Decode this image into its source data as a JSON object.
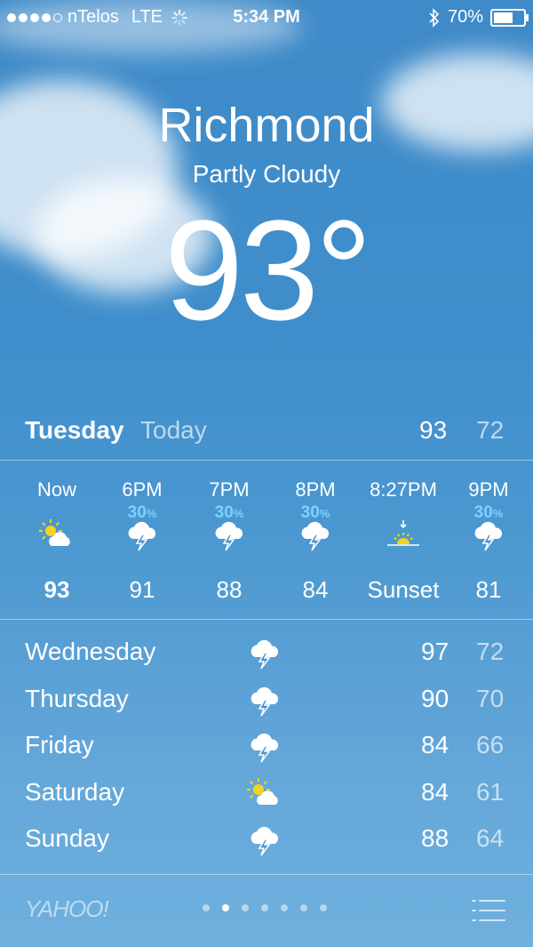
{
  "status": {
    "carrier": "nTelos",
    "network": "LTE",
    "time": "5:34 PM",
    "battery": "70%",
    "battery_level": 0.7,
    "signal_bars": 4,
    "icons": [
      "signal-dots-icon",
      "activity-spinner-icon",
      "bluetooth-icon",
      "battery-icon"
    ]
  },
  "location": {
    "city": "Richmond",
    "condition": "Partly Cloudy",
    "temperature": "93°"
  },
  "today": {
    "day": "Tuesday",
    "label": "Today",
    "high": "93",
    "low": "72"
  },
  "hourly": [
    {
      "time": "Now",
      "chance": "",
      "icon": "partly-sunny-icon",
      "value": "93"
    },
    {
      "time": "6PM",
      "chance": "30",
      "icon": "thunderstorm-icon",
      "value": "91"
    },
    {
      "time": "7PM",
      "chance": "30",
      "icon": "thunderstorm-icon",
      "value": "88"
    },
    {
      "time": "8PM",
      "chance": "30",
      "icon": "thunderstorm-icon",
      "value": "84"
    },
    {
      "time": "8:27PM",
      "chance": "",
      "icon": "sunset-icon",
      "value": "Sunset"
    },
    {
      "time": "9PM",
      "chance": "30",
      "icon": "thunderstorm-icon",
      "value": "81"
    }
  ],
  "percent_sign": "%",
  "daily": [
    {
      "day": "Wednesday",
      "icon": "thunderstorm-icon",
      "high": "97",
      "low": "72"
    },
    {
      "day": "Thursday",
      "icon": "thunderstorm-icon",
      "high": "90",
      "low": "70"
    },
    {
      "day": "Friday",
      "icon": "thunderstorm-icon",
      "high": "84",
      "low": "66"
    },
    {
      "day": "Saturday",
      "icon": "partly-sunny-icon",
      "high": "84",
      "low": "61"
    },
    {
      "day": "Sunday",
      "icon": "thunderstorm-icon",
      "high": "88",
      "low": "64"
    }
  ],
  "footer": {
    "brand": "YAHOO!",
    "page_count": 7,
    "active_page": 2,
    "list_icon": "list-icon"
  },
  "colors": {
    "precip": "#7fd0ff",
    "sun": "#f5d31c"
  }
}
